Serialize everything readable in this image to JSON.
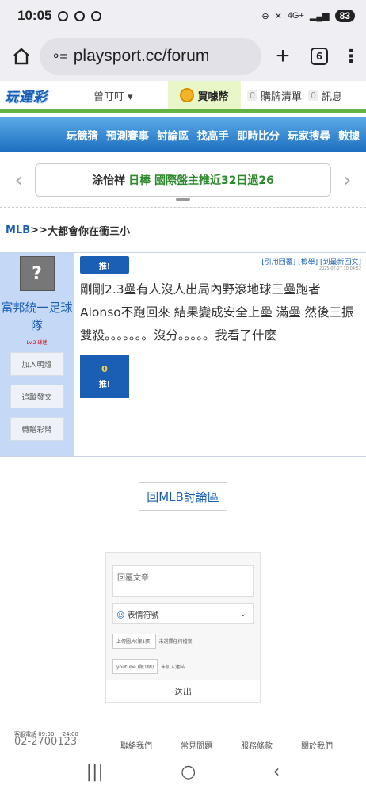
{
  "status": {
    "time": "10:05",
    "battery": "83",
    "signal": "4G+"
  },
  "browser": {
    "url": "playsport.cc/forum",
    "tab_count": "6"
  },
  "site_nav": {
    "logo": "玩運彩",
    "user": "曾叮叮 ▾",
    "buy_coin": "買噱幣",
    "cart_count": "0",
    "cart_label": "購牌清單",
    "msg_count": "0",
    "msg_label": "訊息"
  },
  "menu": [
    "玩競猜",
    "預測賽事",
    "討論區",
    "找高手",
    "即時比分",
    "玩家搜尋",
    "數據"
  ],
  "ticker": {
    "name": "涂怡祥",
    "text": "日棒 國際盤主推近32日過26"
  },
  "breadcrumb": {
    "board": "MLB",
    "sep": " >> ",
    "title": "大都會你在衝三小"
  },
  "post": {
    "author": "富邦統一足球隊",
    "level": "Lv.2 球迷",
    "side_buttons": [
      "加入明燈",
      "追蹤發文",
      "轉贈彩幣"
    ],
    "push_label": "推!",
    "actions": "[引用回覆] [檢舉] [到最新回文]",
    "timestamp": "2025-07-27 10:04:52",
    "text": "剛剛2.3壘有人沒人出局內野滾地球三壘跑者Alonso不跑回來 結果變成安全上壘 滿壘 然後三振雙殺。。。。。。。沒分。。。。。我看了什麼",
    "vote_count": "0",
    "vote_label": "推!"
  },
  "back_button": "回MLB討論區",
  "reply": {
    "placeholder": "回覆文章",
    "emoji": "表情符號",
    "upload_img": "上傳圖片(限1張)",
    "upload_img_status": "未選擇任何檔案",
    "youtube": "youtube (限1個)",
    "youtube_status": "未加入連結",
    "send": "送出"
  },
  "footer": {
    "phone_label": "客服電話 09:30 ~ 24:00",
    "phone": "02-2700123",
    "links": [
      "聯絡我們",
      "常見問題",
      "服務條款",
      "關於我們"
    ]
  },
  "nav": {
    "recents": "|||",
    "home": "○",
    "back": "‹"
  }
}
